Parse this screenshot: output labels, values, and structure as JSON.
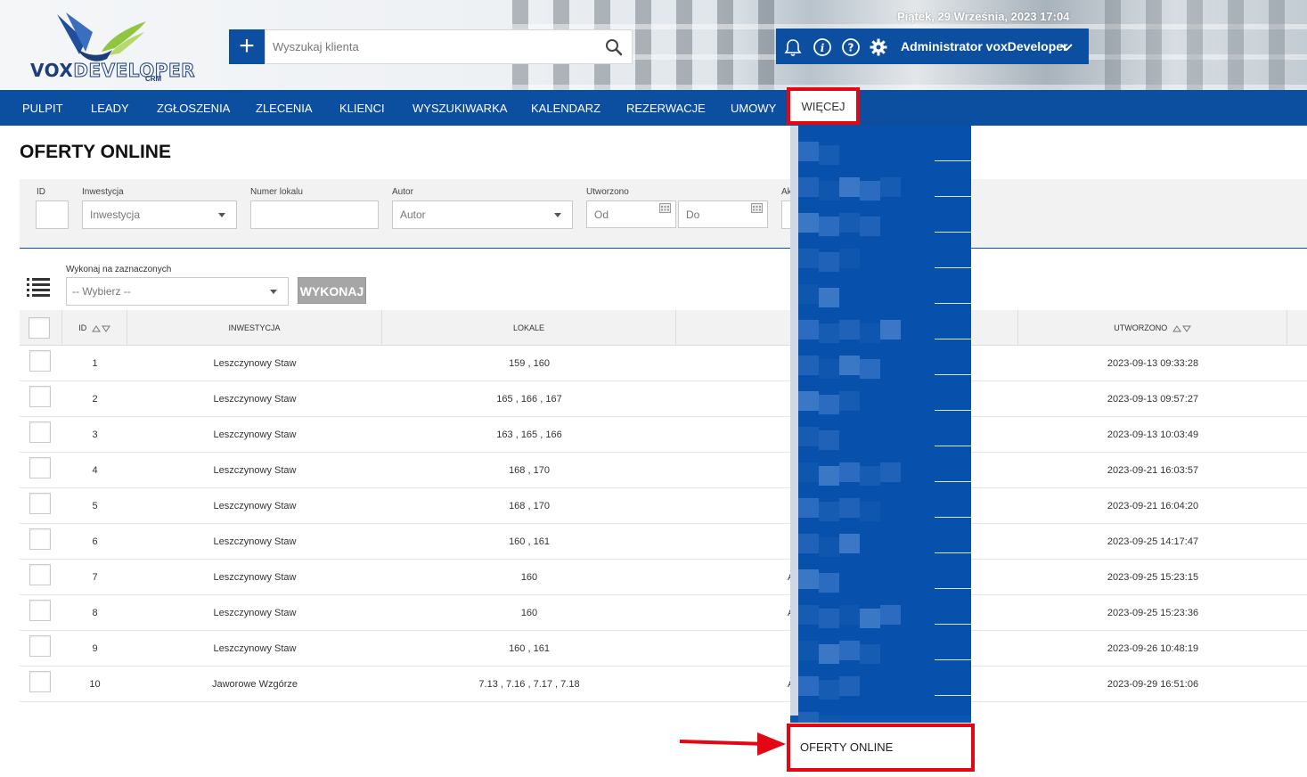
{
  "header": {
    "logo_brand_a": "VOX",
    "logo_brand_b": "DEVELOPER",
    "logo_sub": "CRM",
    "search_placeholder": "Wyszukaj klienta",
    "date": "Piątek, 29 Września, 2023   17:04",
    "user": "Administrator voxDeveloper"
  },
  "nav": {
    "items": [
      "PULPIT",
      "LEADY",
      "ZGŁOSZENIA",
      "ZLECENIA",
      "KLIENCI",
      "WYSZUKIWARKA",
      "KALENDARZ",
      "REZERWACJE",
      "UMOWY"
    ],
    "more": "WIĘCEJ"
  },
  "page": {
    "title": "OFERTY ONLINE"
  },
  "filters": {
    "id_label": "ID",
    "investment_label": "Inwestycja",
    "investment_placeholder": "Inwestycja",
    "unit_label": "Numer lokalu",
    "author_label": "Autor",
    "author_placeholder": "Autor",
    "created_label": "Utworzono",
    "from_placeholder": "Od",
    "to_placeholder": "Do",
    "cut_label": "Ak"
  },
  "actions": {
    "label": "Wykonaj na zaznaczonych",
    "select_placeholder": "-- Wybierz --",
    "button": "WYKONAJ"
  },
  "table": {
    "columns": {
      "id": "ID",
      "investment": "INWESTYCJA",
      "units": "LOKALE",
      "created": "UTWORZONO"
    },
    "rows": [
      {
        "id": "1",
        "investment": "Leszczynowy Staw",
        "units": "159 , 160",
        "autor": "",
        "created": "2023-09-13 09:33:28"
      },
      {
        "id": "2",
        "investment": "Leszczynowy Staw",
        "units": "165 , 166 , 167",
        "autor": "",
        "created": "2023-09-13 09:57:27"
      },
      {
        "id": "3",
        "investment": "Leszczynowy Staw",
        "units": "163 , 165 , 166",
        "autor": "",
        "created": "2023-09-13 10:03:49"
      },
      {
        "id": "4",
        "investment": "Leszczynowy Staw",
        "units": "168 , 170",
        "autor": "",
        "created": "2023-09-21 16:03:57"
      },
      {
        "id": "5",
        "investment": "Leszczynowy Staw",
        "units": "168 , 170",
        "autor": "",
        "created": "2023-09-21 16:04:20"
      },
      {
        "id": "6",
        "investment": "Leszczynowy Staw",
        "units": "160 , 161",
        "autor": "",
        "created": "2023-09-25 14:17:47"
      },
      {
        "id": "7",
        "investment": "Leszczynowy Staw",
        "units": "160",
        "autor": "A",
        "created": "2023-09-25 15:23:15"
      },
      {
        "id": "8",
        "investment": "Leszczynowy Staw",
        "units": "160",
        "autor": "A",
        "created": "2023-09-25 15:23:36"
      },
      {
        "id": "9",
        "investment": "Leszczynowy Staw",
        "units": "160 , 161",
        "autor": "",
        "created": "2023-09-26 10:48:19"
      },
      {
        "id": "10",
        "investment": "Jaworowe Wzgórze",
        "units": "7.13 , 7.16 , 7.17 , 7.18",
        "autor": "A",
        "created": "2023-09-29 16:51:06"
      }
    ]
  },
  "dropdown": {
    "highlighted_item": "OFERTY ONLINE"
  },
  "colors": {
    "brand_blue": "#0c4fa0",
    "highlight_red": "#e30613"
  }
}
